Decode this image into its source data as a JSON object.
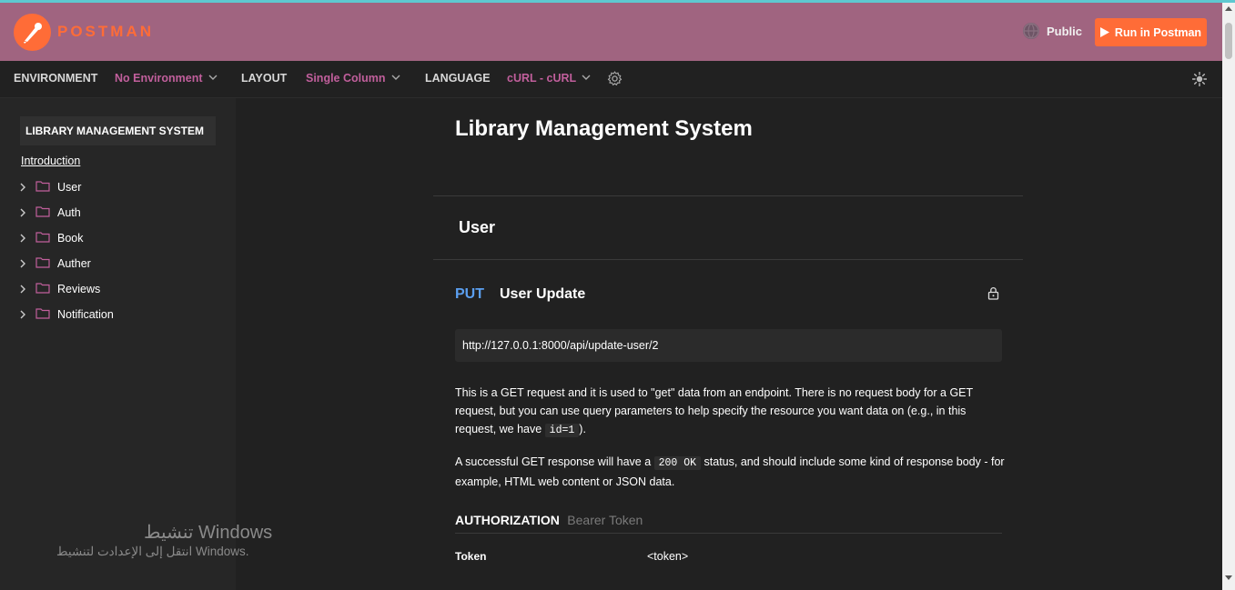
{
  "header": {
    "logo_text": "POSTMAN",
    "visibility": "Public",
    "run_button": "Run in Postman",
    "brand_color": "#ff6c37",
    "bar_color": "#a06480"
  },
  "toolbar": {
    "environment_label": "ENVIRONMENT",
    "environment_value": "No Environment",
    "layout_label": "LAYOUT",
    "layout_value": "Single Column",
    "language_label": "LANGUAGE",
    "language_value": "cURL - cURL",
    "icons": [
      "gear-icon",
      "sun-icon"
    ]
  },
  "sidebar": {
    "collection_title": "LIBRARY MANAGEMENT SYSTEM",
    "intro_link": "Introduction",
    "folders": [
      {
        "label": "User"
      },
      {
        "label": "Auth"
      },
      {
        "label": "Book"
      },
      {
        "label": "Auther"
      },
      {
        "label": "Reviews"
      },
      {
        "label": "Notification"
      }
    ]
  },
  "main": {
    "title": "Library Management System",
    "section_title": "User",
    "request": {
      "method": "PUT",
      "method_color": "#5b9ff0",
      "name": "User Update",
      "url": "http://127.0.0.1:8000/api/update-user/2",
      "description_p1_a": "This is a GET request and it is used to \"get\" data from an endpoint. There is no request body for a GET request, but you can use query parameters to help specify the resource you want data on (e.g., in this request, we have ",
      "description_p1_code": "id=1",
      "description_p1_b": ").",
      "description_p2_a": "A successful GET response will have a ",
      "description_p2_code": "200 OK",
      "description_p2_b": " status, and should include some kind of response body - for example, HTML web content or JSON data.",
      "auth_title": "AUTHORIZATION",
      "auth_type": "Bearer Token",
      "token_key": "Token",
      "token_value": "<token>"
    }
  },
  "watermark": {
    "line1": "تنشيط Windows",
    "line2": "انتقل إلى الإعدادت لتنشيط Windows."
  }
}
